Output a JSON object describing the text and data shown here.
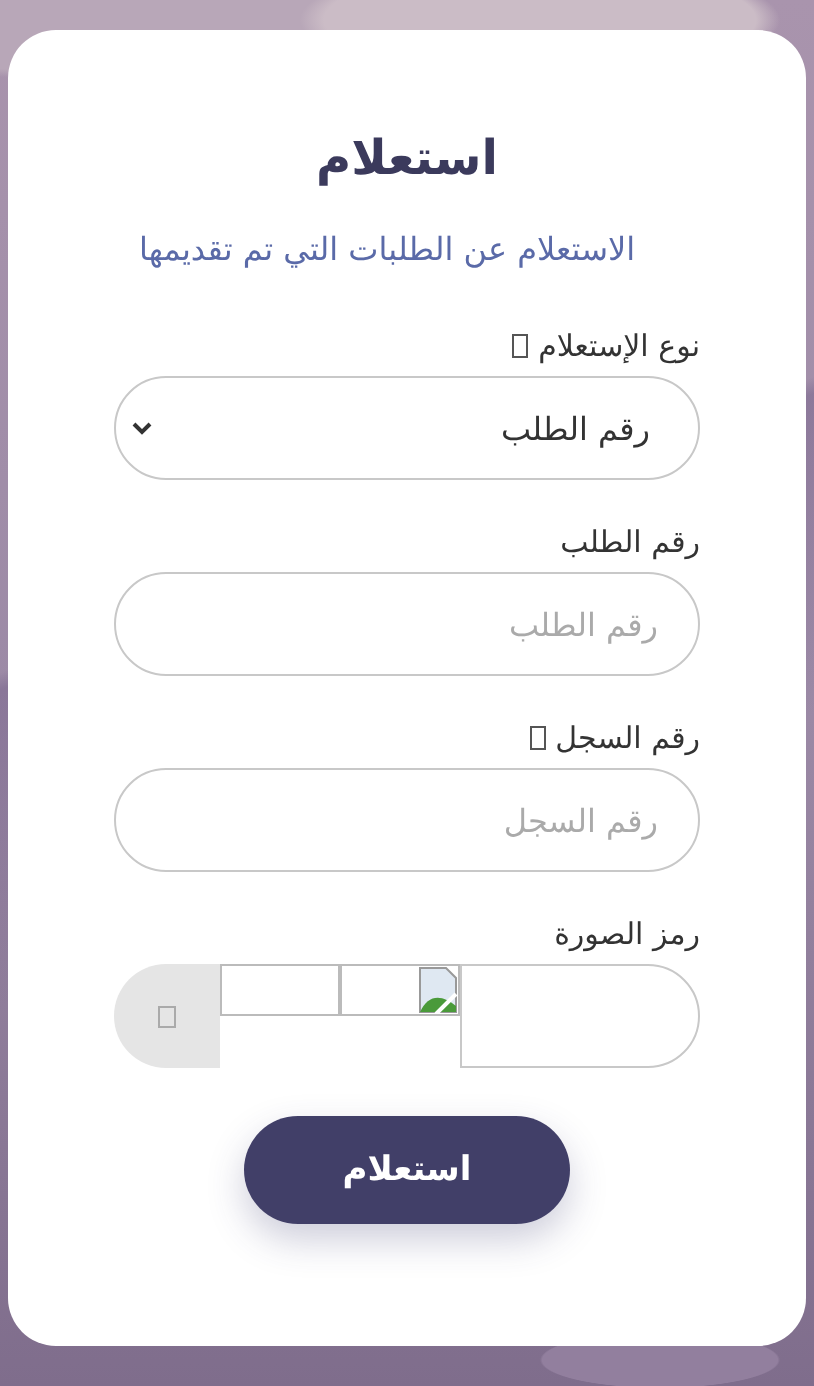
{
  "title": "استعلام",
  "subtitle": "الاستعلام عن الطلبات التي تم تقديمها",
  "fields": [
    {
      "kind": "select",
      "label": "نوع الإستعلام",
      "flagged": true,
      "value": "رقم الطلب"
    },
    {
      "kind": "text",
      "label": "رقم الطلب",
      "flagged": false,
      "placeholder": "رقم الطلب"
    },
    {
      "kind": "text",
      "label": "رقم السجل",
      "flagged": true,
      "placeholder": "رقم السجل"
    },
    {
      "kind": "captcha",
      "label": "رمز الصورة",
      "flagged": false
    }
  ],
  "submit": {
    "label": "استعلام"
  }
}
